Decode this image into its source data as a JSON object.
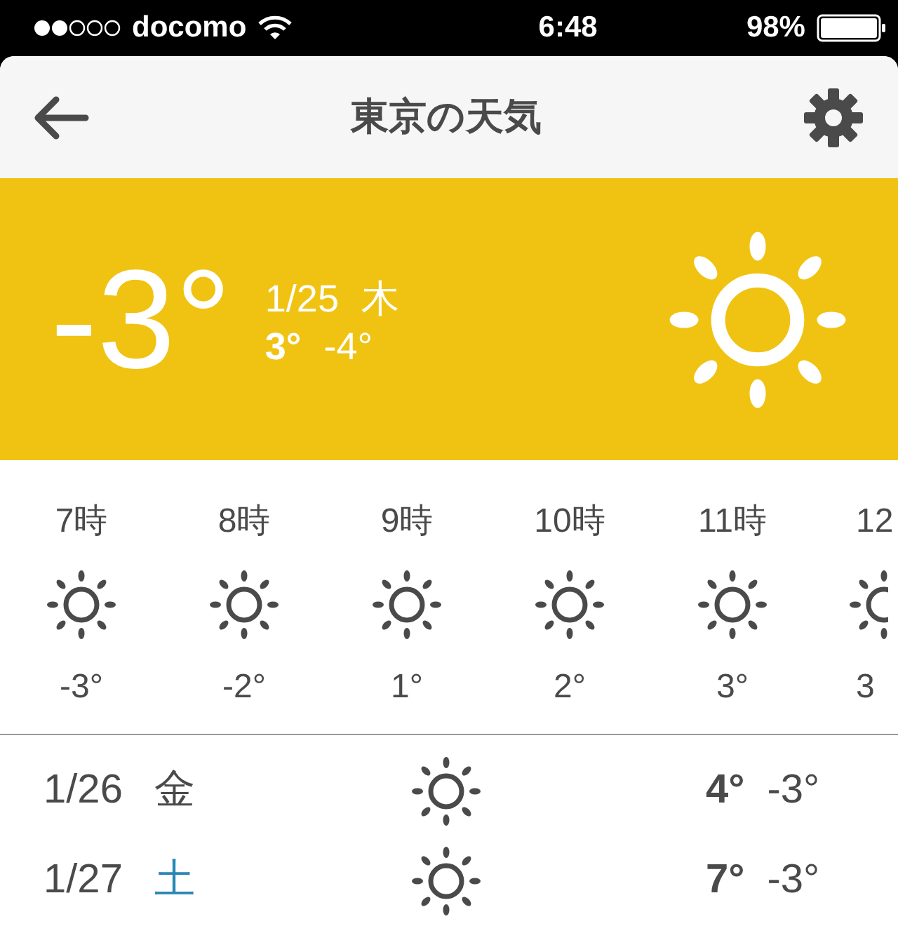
{
  "status_bar": {
    "carrier": "docomo",
    "time": "6:48",
    "battery": "98%"
  },
  "nav": {
    "title": "東京の天気"
  },
  "current": {
    "temp": "-3°",
    "date": "1/25",
    "weekday": "木",
    "high": "3°",
    "low": "-4°"
  },
  "hourly": [
    {
      "hour": "7時",
      "temp": "-3°"
    },
    {
      "hour": "8時",
      "temp": "-2°"
    },
    {
      "hour": "9時",
      "temp": "1°"
    },
    {
      "hour": "10時",
      "temp": "2°"
    },
    {
      "hour": "11時",
      "temp": "3°"
    },
    {
      "hour": "12",
      "temp": "3"
    }
  ],
  "daily": [
    {
      "date": "1/26",
      "weekday": "金",
      "color": "#4a4a4a",
      "high": "4°",
      "low": "-3°"
    },
    {
      "date": "1/27",
      "weekday": "土",
      "color": "#2a87b5",
      "high": "7°",
      "low": "-3°"
    }
  ]
}
